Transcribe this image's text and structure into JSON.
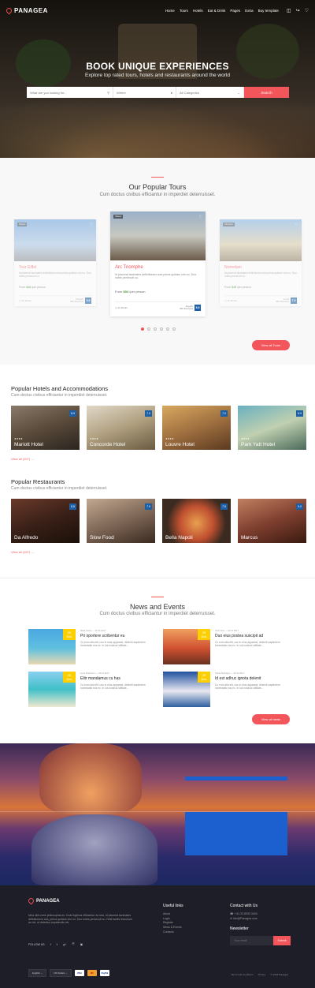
{
  "brand": "PANAGEA",
  "nav": [
    "Home",
    "Tours",
    "Hotels",
    "Eat & Drink",
    "Pages",
    "Extra",
    "Buy template"
  ],
  "hero": {
    "title": "BOOK UNIQUE EXPERIENCES",
    "subtitle": "Explore top rated tours, hotels and restaurants around the world"
  },
  "search": {
    "what": "What are you looking for...",
    "where": "Where",
    "category": "All Categories",
    "button": "Search"
  },
  "tours": {
    "title": "Our Popular Tours",
    "subtitle": "Cum doctus civibus efficiantur in imperdiet deterruisset.",
    "button": "View all Tours",
    "items": [
      {
        "tag": "Historic",
        "name": "Tour Eiffel",
        "desc": "Id placerat tacimates definitionem sea prima quidam vim no. Duo nobis persecuti cu.",
        "price": "$48",
        "unit": "/per person",
        "dur": "1h 30min",
        "label": "Superb",
        "reviews": "350 Reviews",
        "score": "8.9"
      },
      {
        "tag": "Historic",
        "name": "Arc Triomphe",
        "desc": "Id placerat tacimates definitionem sea prima quidam vim no. Duo nobis persecuti cu.",
        "price": "$54",
        "unit": "/per person",
        "dur": "1h 30min",
        "label": "Superb",
        "reviews": "350 Reviews",
        "score": "8.9"
      },
      {
        "tag": "Churches",
        "name": "Notredam",
        "desc": "Id placerat tacimates definitionem sea prima quidam vim no. Duo nobis persecuti cu.",
        "price": "$48",
        "unit": "/per person",
        "dur": "1h 30min",
        "label": "Good",
        "reviews": "350 Reviews",
        "score": "7.5"
      }
    ]
  },
  "hotels": {
    "title": "Popular Hotels and Accommodations",
    "subtitle": "Cum doctus civibus efficiantur in imperdiet deterruisset.",
    "view": "View all (157)",
    "items": [
      {
        "name": "Mariott Hotel",
        "score": "8.9"
      },
      {
        "name": "Concorde Hotel",
        "score": "7.0"
      },
      {
        "name": "Louvre Hotel",
        "score": "7.0"
      },
      {
        "name": "Park Yatt Hotel",
        "score": "8.9"
      }
    ]
  },
  "restaurants": {
    "title": "Popular Restaurants",
    "subtitle": "Cum doctus civibus efficiantur in imperdiet deterruisset.",
    "view": "View all (157)",
    "items": [
      {
        "name": "Da Alfredo",
        "score": "8.5"
      },
      {
        "name": "Slow Food",
        "score": "7.9"
      },
      {
        "name": "Bella Napoli",
        "score": "7.5"
      },
      {
        "name": "Marcus",
        "score": "9.0"
      }
    ]
  },
  "news": {
    "title": "News and Events",
    "subtitle": "Cum doctus civibus efficiantur in imperdiet deterruisset.",
    "button": "View all news",
    "items": [
      {
        "day": "28",
        "mon": "Dec",
        "meta": "Mark Twain  —  20.11.2017",
        "title": "Pri oportere scribentur eu",
        "text": "Cu eum alia elit, usu in eius appareat, deleniti sapientem honestatis eos ex. In ius nostrud utilitate..."
      },
      {
        "day": "28",
        "mon": "Dec",
        "meta": "Jhon Doe  —  20.11.2017",
        "title": "Duo eius postea suscipit ad",
        "text": "Cu eum alia elit, usu in eius appareat, deleniti sapientem honestatis eos ex. In ius nostrud utilitate..."
      },
      {
        "day": "28",
        "mon": "Dec",
        "meta": "Luca Robinson  —  20.11.2017",
        "title": "Elitr mandamus cu has",
        "text": "Cu eum alia elit, usu in eius appareat, deleniti sapientem honestatis eos ex. In ius nostrud utilitate..."
      },
      {
        "day": "28",
        "mon": "Dec",
        "meta": "Paula Rodrigez  —  20.11.2017",
        "title": "Id est adhuc ignota delenit",
        "text": "Cu eum alia elit, usu in eius appareat, deleniti sapientem honestatis eos ex. In ius nostrud utilitate..."
      }
    ]
  },
  "footer": {
    "about": "Mea nibh meis philosophia eu. Duis legimus efficiantur ea sea. Id placerat tacimates definitionem sea, prima quidam vim no. Duo nobis persecuti cu. Nihil facilisi indoctum an vix, ut delectus expetendis vis.",
    "follow": "Follow us",
    "social": [
      "f",
      "t",
      "g+",
      "p",
      "ig"
    ],
    "useful_title": "Useful links",
    "useful": [
      "About",
      "Login",
      "Register",
      "News & Events",
      "Contacts"
    ],
    "contact_title": "Contact with Us",
    "phone": "+ 61 23 8093 3400",
    "email": "info@Panagea.com",
    "newsletter_title": "Newsletter",
    "newsletter_placeholder": "Your email",
    "newsletter_btn": "Submit",
    "lang": "English",
    "currency": "US Dollars",
    "cards": [
      "VISA",
      "MC",
      "PayPal"
    ],
    "links": [
      "Terms and conditions",
      "Privacy",
      "© 2018 Panagea"
    ]
  },
  "colors": {
    "accent": "#f2555a",
    "badge": "#1c5fa6",
    "footer": "#1e1e28"
  }
}
